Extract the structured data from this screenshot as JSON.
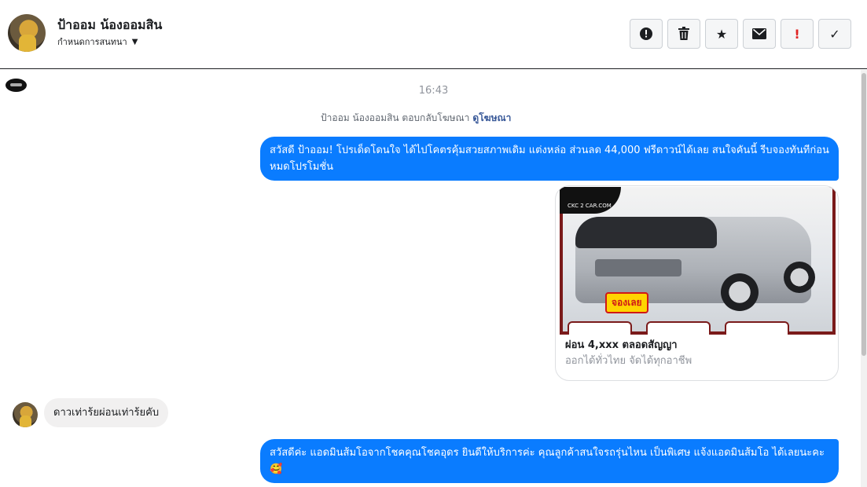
{
  "header": {
    "name": "ป้าออม น้องออมสิน",
    "assign_label": "กำหนดการสนทนา",
    "assign_caret_icon": "caret-down-icon"
  },
  "toolbar": {
    "buttons": [
      {
        "name": "report-button",
        "icon": "alert-circle-icon",
        "glyph": "⏺"
      },
      {
        "name": "delete-button",
        "icon": "trash-icon",
        "glyph": "🗑"
      },
      {
        "name": "star-button",
        "icon": "star-icon",
        "glyph": "★"
      },
      {
        "name": "mark-unread-button",
        "icon": "envelope-icon",
        "glyph": "✉"
      },
      {
        "name": "spam-button",
        "icon": "exclamation-icon",
        "glyph": "!"
      },
      {
        "name": "done-button",
        "icon": "check-icon",
        "glyph": "✓"
      }
    ]
  },
  "chat": {
    "timestamp": "16:43",
    "notice_text": "ป้าออม น้องออมสิน ตอบกลับโฆษณา",
    "notice_link": "ดูโฆษณา",
    "messages": {
      "out1": "สวัสดี ป้าออม! โปรเด็ดโดนใจ ได้ไปโคตรคุ้มสวยสภาพเดิม แต่งหล่อ  ส่วนลด 44,000 ฟรีดาวน์ได้เลย  สนใจคันนี้ รีบจองทันทีก่อนหมดโปรโมชั่น",
      "in1": "ดาวเท่าร้ยผ่อนเท่าร้ยคับ",
      "out2": "สวัสดีค่ะ แอดมินส้มโอจากโชคคุณโชคอุดร ยินดีให้บริการค่ะ   คุณลูกค้าสนใจรถรุ่นไหน เป็นพิเศษ แจ้งแอดมินส้มโอ ได้เลยนะคะ🥰"
    },
    "ad_card": {
      "image_logo_text": "CKC 2 CAR.COM",
      "image_badge_text": "จองเลย",
      "title": "ผ่อน 4,xxx ตลอดสัญญา",
      "subtitle": "ออกได้ทั่วไทย จัดได้ทุกอาชีพ"
    }
  },
  "colors": {
    "outgoing_bubble": "#0a7cff",
    "incoming_bubble": "#f1f0f0",
    "link": "#385898",
    "spam_red": "#e02424"
  }
}
